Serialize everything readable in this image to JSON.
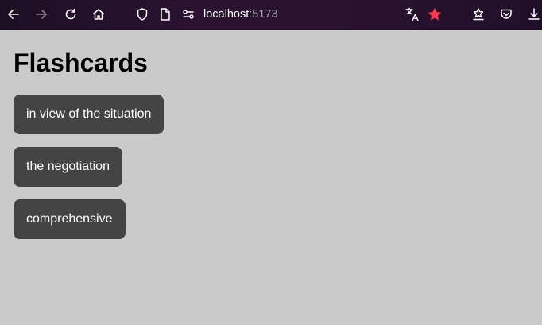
{
  "browser": {
    "url_host": "localhost",
    "url_port": ":5173",
    "icons": {
      "back": "back-arrow-icon",
      "forward": "forward-arrow-icon",
      "reload": "reload-icon",
      "home": "home-icon",
      "shield": "shield-icon",
      "page": "page-icon",
      "permissions": "permissions-icon",
      "translate": "translate-icon",
      "bookmark": "star-icon",
      "extensions": "extensions-icon",
      "pocket": "pocket-icon",
      "downloads": "download-icon"
    },
    "colors": {
      "bookmark_star": "#ff3a4e",
      "toolbar_bg": "#2a1230"
    }
  },
  "page": {
    "title": "Flashcards",
    "cards": [
      {
        "label": "in view of the situation"
      },
      {
        "label": "the negotiation"
      },
      {
        "label": "comprehensive"
      }
    ],
    "colors": {
      "background": "#cacaca",
      "card": "#444444",
      "card_text": "#ffffff"
    }
  }
}
